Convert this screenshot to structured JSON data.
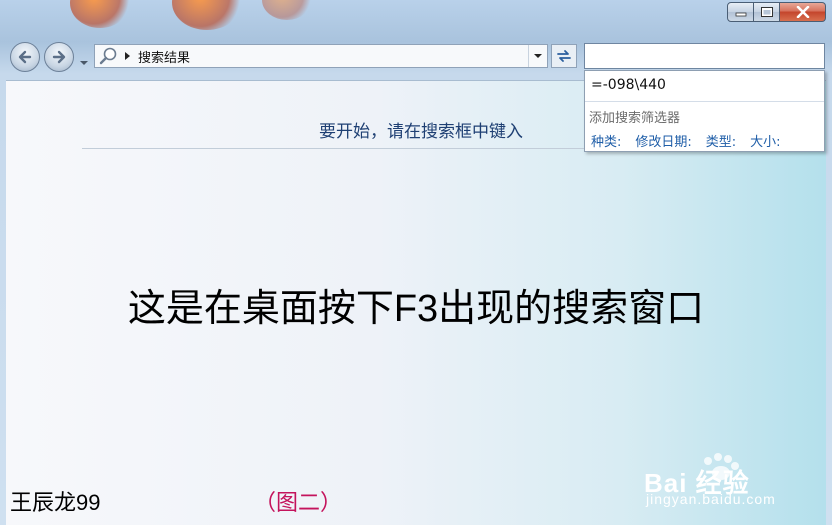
{
  "toolbar": {
    "address_text": "搜索结果"
  },
  "search": {
    "value": "",
    "placeholder": ""
  },
  "dropdown": {
    "query": "=-098\\440",
    "filter_title": "添加搜索筛选器",
    "filters": [
      "种类:",
      "修改日期:",
      "类型:",
      "大小:"
    ]
  },
  "content": {
    "hint": "要开始，请在搜索框中键入",
    "headline": "这是在桌面按下F3出现的搜索窗口",
    "author": "王辰龙99",
    "figure_label": "（图二）"
  },
  "watermark": {
    "brand": "Bai 经验",
    "url": "jingyan.baidu.com"
  },
  "colors": {
    "link_blue": "#1f5ea8",
    "figure_label": "#c4135c",
    "hint_text": "#1e3f73"
  }
}
